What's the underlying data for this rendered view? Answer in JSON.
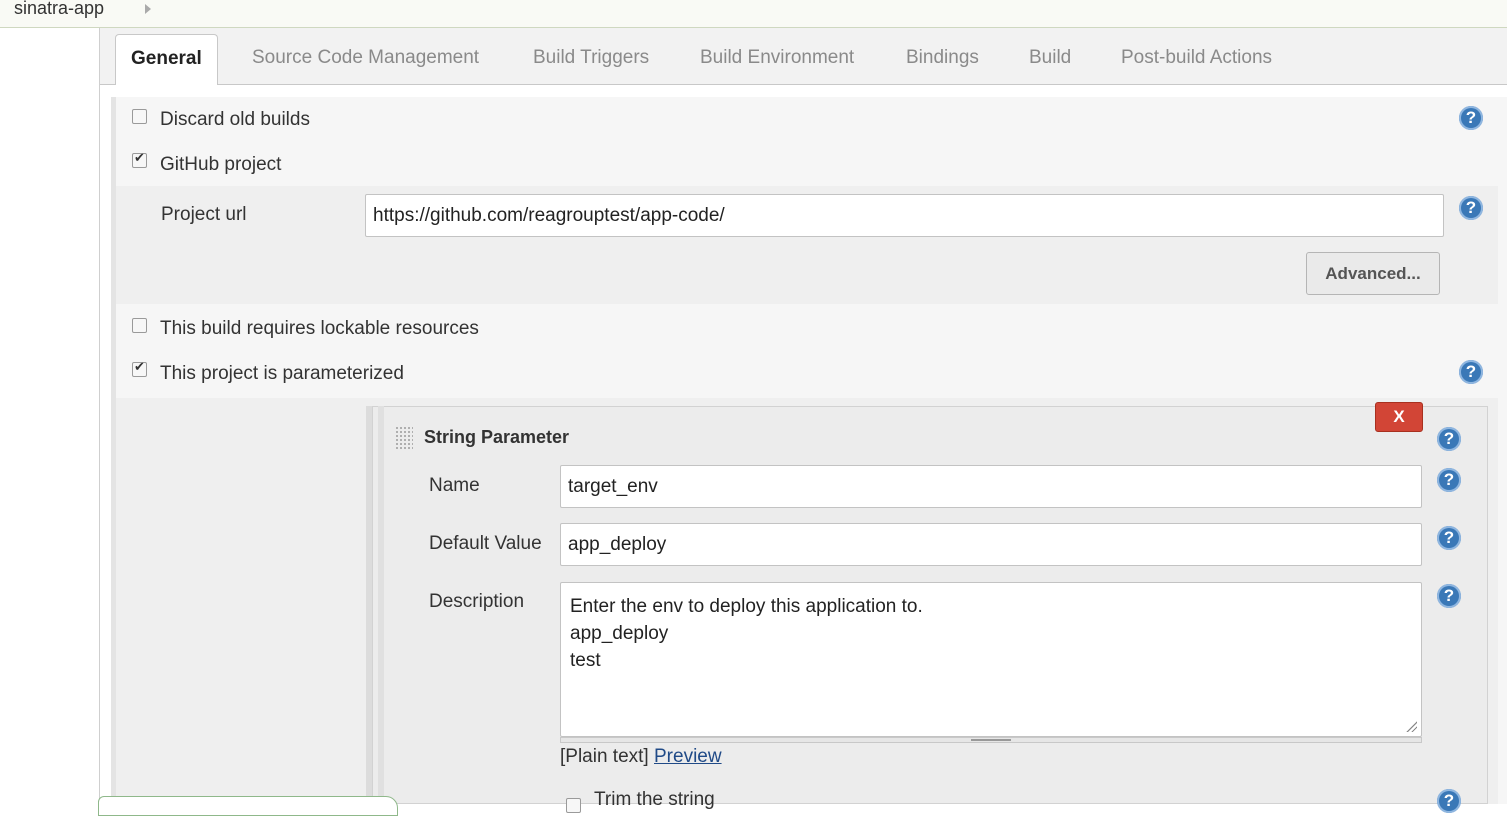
{
  "breadcrumb": {
    "project": "sinatra-app"
  },
  "tabs": [
    {
      "label": "General",
      "active": true
    },
    {
      "label": "Source Code Management"
    },
    {
      "label": "Build Triggers"
    },
    {
      "label": "Build Environment"
    },
    {
      "label": "Bindings"
    },
    {
      "label": "Build"
    },
    {
      "label": "Post-build Actions"
    }
  ],
  "general": {
    "discard_old_builds": {
      "label": "Discard old builds",
      "checked": false
    },
    "github_project": {
      "label": "GitHub project",
      "checked": true
    },
    "project_url": {
      "label": "Project url",
      "value": "https://github.com/reagrouptest/app-code/"
    },
    "advanced_label": "Advanced...",
    "lockable_resources": {
      "label": "This build requires lockable resources",
      "checked": false
    },
    "parameterized": {
      "label": "This project is parameterized",
      "checked": true
    }
  },
  "string_parameter": {
    "title": "String Parameter",
    "delete_label": "X",
    "name_label": "Name",
    "name_value": "target_env",
    "default_label": "Default Value",
    "default_value": "app_deploy",
    "description_label": "Description",
    "description_value": "Enter the env to deploy this application to.\napp_deploy\ntest",
    "plain_text": "[Plain text]",
    "preview_label": "Preview",
    "trim_label": "Trim the string"
  },
  "help_glyph": "?",
  "colors": {
    "help_icon": "#3a78b7",
    "delete_button": "#d24536",
    "link": "#204a87"
  }
}
